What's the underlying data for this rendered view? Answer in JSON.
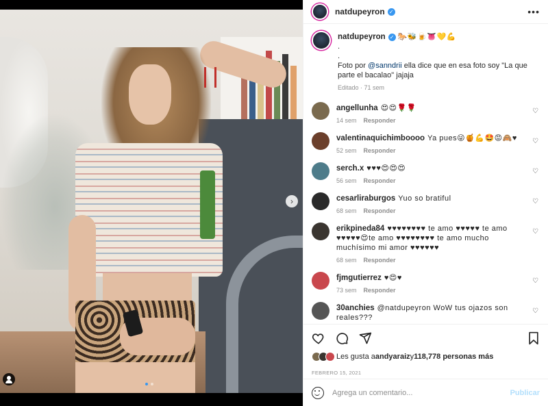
{
  "post": {
    "author": "natdupeyron",
    "caption": {
      "emojis": "🐎🐝🍺👅💛💪",
      "dot1": ".",
      "dot2": ".",
      "text_before": "Foto por ",
      "mention": "@sanndrii",
      "text_after": " ella dice que en esa foto soy \"La que parte el bacalao\" jajaja",
      "meta": "Editado · 71 sem"
    },
    "reply_label": "Responder"
  },
  "comments": [
    {
      "user": "angellunha",
      "text": "😍😍🌹🌹",
      "time": "14 sem",
      "avatar_color": "#7a6a4e"
    },
    {
      "user": "valentinaquichimboooo",
      "text": "Ya pues😜🍯💪🤩😡🙈♥",
      "time": "52 sem",
      "avatar_color": "#6b3f2b"
    },
    {
      "user": "serch.x",
      "text": "♥♥♥😍😍😍",
      "time": "56 sem",
      "avatar_color": "#4e7c8a"
    },
    {
      "user": "cesarliraburgos",
      "text": "Yuo so bratiful",
      "time": "68 sem",
      "avatar_color": "#2a2a2a"
    },
    {
      "user": "erikpineda84",
      "text": "♥♥♥♥♥♥♥♥ te amo ♥♥♥♥♥ te amo ♥♥♥♥♥😍te amo ♥♥♥♥♥♥♥♥ te amo mucho muchísimo mi amor ♥♥♥♥♥♥",
      "time": "68 sem",
      "avatar_color": "#3a3530"
    },
    {
      "user": "fjmgutierrez",
      "text": "♥😍♥",
      "time": "73 sem",
      "avatar_color": "#c9474d"
    },
    {
      "user": "30anchies",
      "text": "@natdupeyron WoW tus ojazos son reales???",
      "time": "",
      "avatar_color": "#555555"
    }
  ],
  "likes": {
    "prefix": "Les gusta a ",
    "user": "andyaraiz",
    "middle": " y ",
    "count": "118,778 personas más"
  },
  "date": "FEBRERO 15, 2021",
  "comment_box": {
    "placeholder": "Agrega un comentario...",
    "publish_label": "Publicar"
  },
  "icons": {
    "like": "heart-icon",
    "comment": "comment-icon",
    "share": "share-icon",
    "save": "bookmark-icon",
    "more": "more-icon"
  }
}
